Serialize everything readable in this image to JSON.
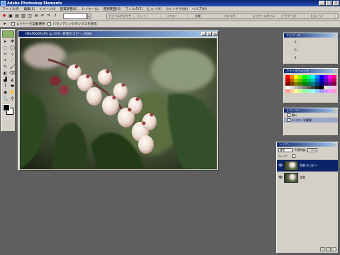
{
  "app": {
    "title": "Adobe Photoshop Elements",
    "window_buttons": [
      "_",
      "□",
      "×"
    ]
  },
  "menu": [
    "ファイル(F)",
    "編集(E)",
    "イメージ(I)",
    "画質調整(E)",
    "レイヤー(L)",
    "選択範囲(S)",
    "フィルタ(T)",
    "ビュー(V)",
    "ウィンドウ(W)",
    "ヘルプ(H)"
  ],
  "toolbar": {
    "icons": [
      "new-icon",
      "open-icon",
      "save-icon",
      "print-icon",
      "web-icon",
      "email-icon",
      "undo-icon",
      "redo-icon",
      "help-icon"
    ],
    "glyphs": [
      "✱",
      "▣",
      "▤",
      "▥",
      "◫",
      "✉",
      "↶",
      "↷",
      "?"
    ],
    "palette_well_tabs": [
      "ファイルブラウザ",
      "ヒント",
      "ハウツー",
      "効果",
      "フィルタ",
      "レイヤースタイル",
      "ナビゲータ",
      "ヒストリー"
    ]
  },
  "options": {
    "items": [
      "レイヤーを自動選択",
      "バウンディングボックスを表示"
    ]
  },
  "tools": [
    "▸",
    "✥",
    "⬚",
    "◯",
    "✂",
    "⊹",
    "⌖",
    "⟋",
    "✎",
    "🖌",
    "◐",
    "⌫",
    "▟",
    "◭",
    "T",
    "⬬",
    "◉",
    "✋",
    "🔍",
    "⚲"
  ],
  "document": {
    "title": "IMGP0009.JPG @ 25% (背景のコピー, RGB)",
    "buttons": [
      "_",
      "□",
      "×"
    ]
  },
  "navigator": {
    "title": "ナビゲータ",
    "values": [
      "R:",
      "",
      "",
      "G:",
      "",
      "",
      "B:",
      "",
      ""
    ]
  },
  "color_swatches": {
    "title": "カラースウォッチ",
    "colors": [
      "#ff0000",
      "#ff8000",
      "#ffff00",
      "#80ff00",
      "#00ff00",
      "#00ff80",
      "#00ffff",
      "#0080ff",
      "#0000ff",
      "#8000ff",
      "#ff00ff",
      "#ff0080",
      "#c00000",
      "#c06000",
      "#c0c000",
      "#60c000",
      "#00c000",
      "#00c060",
      "#00c0c0",
      "#0060c0",
      "#0000c0",
      "#6000c0",
      "#c000c0",
      "#c00060",
      "#800000",
      "#804000",
      "#808000",
      "#408000",
      "#008000",
      "#008040",
      "#008080",
      "#004080",
      "#000080",
      "#400080",
      "#800080",
      "#800040",
      "#ffffff",
      "#e0e0e0",
      "#c0c0c0",
      "#a0a0a0",
      "#808080",
      "#606060",
      "#404040",
      "#202020",
      "#000000",
      "#ffe0c0",
      "#c0e0ff",
      "#ffc0e0",
      "#ff9999",
      "#ffcc99",
      "#ffff99",
      "#ccff99",
      "#99ff99",
      "#99ffcc",
      "#99ffff",
      "#99ccff",
      "#9999ff",
      "#cc99ff",
      "#ff99ff",
      "#ff99cc"
    ]
  },
  "history": {
    "title": "ヒストリー",
    "rows": [
      "開く",
      "レイヤーを複製"
    ]
  },
  "layers": {
    "title": "レイヤー",
    "blend_mode": "通常",
    "opacity_label": "不透明度:",
    "opacity_value": "100%",
    "lock_label": "ロック:",
    "items": [
      "背景 のコピー",
      "背景"
    ]
  }
}
